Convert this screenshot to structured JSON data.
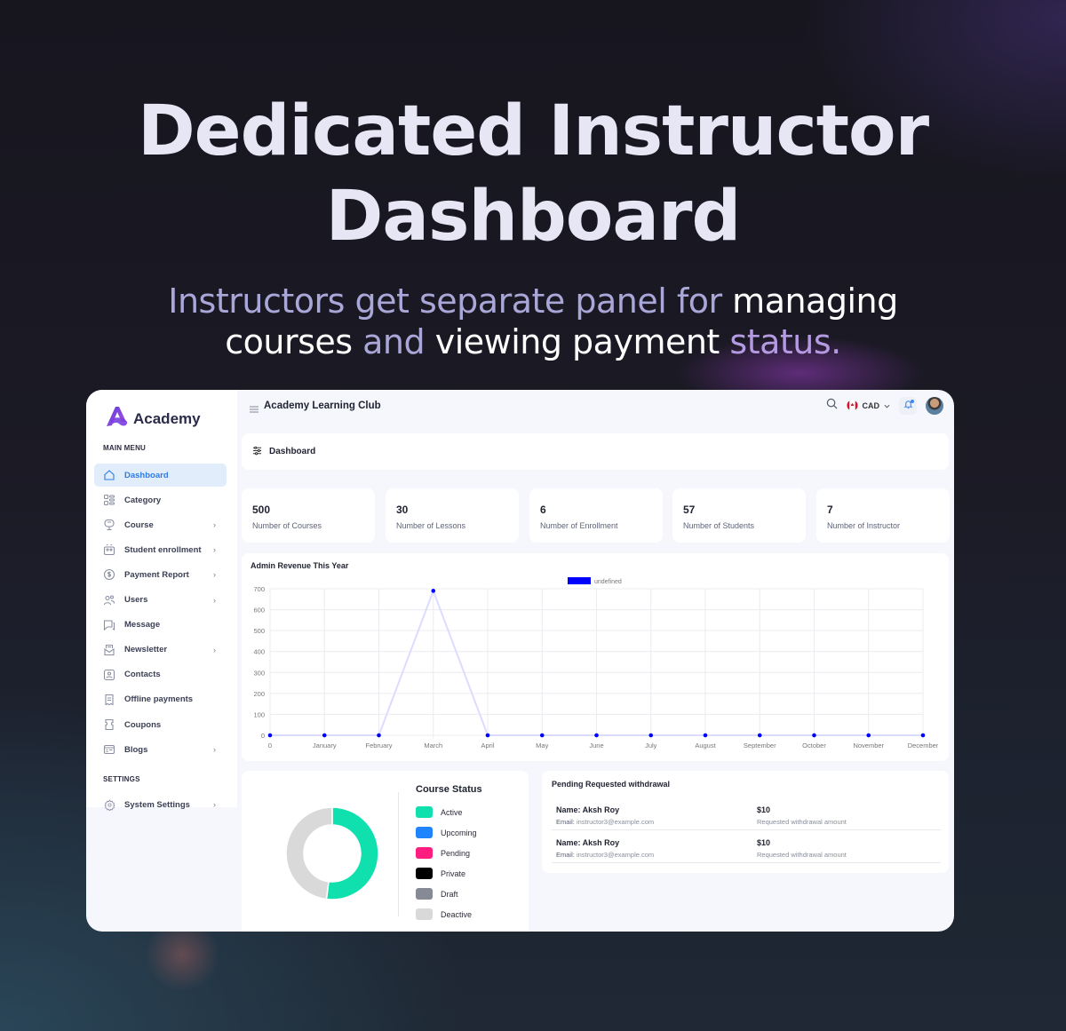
{
  "hero": {
    "title_line1": "Dedicated Instructor",
    "title_line2": "Dashboard",
    "subtitle": {
      "part1": "Instructors get separate panel for ",
      "part2": "managing",
      "part3": "courses",
      "part4": " and ",
      "part5": "viewing payment",
      "part6": " status."
    }
  },
  "sidebar": {
    "logo_text": "Academy",
    "main_menu_label": "MAIN MENU",
    "settings_label": "SETTINGS",
    "items": [
      {
        "label": "Dashboard",
        "icon": "home-icon",
        "active": true,
        "chevron": false
      },
      {
        "label": "Category",
        "icon": "category-icon",
        "chevron": false
      },
      {
        "label": "Course",
        "icon": "course-icon",
        "chevron": true
      },
      {
        "label": "Student enrollment",
        "icon": "students-icon",
        "chevron": true
      },
      {
        "label": "Payment Report",
        "icon": "dollar-icon",
        "chevron": true
      },
      {
        "label": "Users",
        "icon": "users-icon",
        "chevron": true
      },
      {
        "label": "Message",
        "icon": "message-icon",
        "chevron": false
      },
      {
        "label": "Newsletter",
        "icon": "newsletter-icon",
        "chevron": true
      },
      {
        "label": "Contacts",
        "icon": "contact-icon",
        "chevron": false
      },
      {
        "label": "Offline payments",
        "icon": "receipt-icon",
        "chevron": false
      },
      {
        "label": "Coupons",
        "icon": "coupon-icon",
        "chevron": false
      },
      {
        "label": "Blogs",
        "icon": "blog-icon",
        "chevron": true
      }
    ],
    "settings_items": [
      {
        "label": "System Settings",
        "icon": "gear-icon",
        "chevron": true
      }
    ],
    "chevron_glyph": "›"
  },
  "topbar": {
    "title": "Academy Learning Club",
    "currency": "CAD",
    "currency_flag": "canada-flag-icon"
  },
  "page_header": {
    "title": "Dashboard"
  },
  "stats": [
    {
      "value": "500",
      "label": "Number of Courses"
    },
    {
      "value": "30",
      "label": "Number of Lessons"
    },
    {
      "value": "6",
      "label": "Number of Enrollment"
    },
    {
      "value": "57",
      "label": "Number of Students"
    },
    {
      "value": "7",
      "label": "Number of Instructor"
    }
  ],
  "chart_data": [
    {
      "type": "line",
      "title": "Admin Revenue This Year",
      "categories": [
        "0",
        "January",
        "February",
        "March",
        "April",
        "May",
        "June",
        "July",
        "August",
        "September",
        "October",
        "November",
        "December"
      ],
      "series": [
        {
          "name": "undefined",
          "values": [
            0,
            0,
            0,
            690,
            0,
            0,
            0,
            0,
            0,
            0,
            0,
            0,
            0
          ],
          "color": "#0000ff",
          "line_color": "#dcdcff"
        }
      ],
      "yticks": [
        0,
        100,
        200,
        300,
        400,
        500,
        600,
        700
      ],
      "ylim": [
        0,
        700
      ],
      "grid": true,
      "legend": "top-center",
      "xlabel": "",
      "ylabel": ""
    },
    {
      "type": "pie",
      "title": "Course Status",
      "donut": true,
      "categories": [
        "Active",
        "Upcoming",
        "Pending",
        "Private",
        "Draft",
        "Deactive"
      ],
      "values": [
        52,
        0,
        0,
        0,
        0,
        48
      ],
      "colors": [
        "#0fe0ad",
        "#1e84ff",
        "#ff1e80",
        "#000000",
        "#868a95",
        "#d9d9d9"
      ],
      "legend": "right"
    }
  ],
  "withdrawals": {
    "title": "Pending Requested withdrawal",
    "email_prefix": "Email:",
    "rows": [
      {
        "name": "Name: Aksh Roy",
        "email": "instructor3@example.com",
        "amount": "$10",
        "amount_label": "Requested withdrawal amount"
      },
      {
        "name": "Name: Aksh Roy",
        "email": "instructor3@example.com",
        "amount": "$10",
        "amount_label": "Requested withdrawal amount"
      }
    ]
  }
}
